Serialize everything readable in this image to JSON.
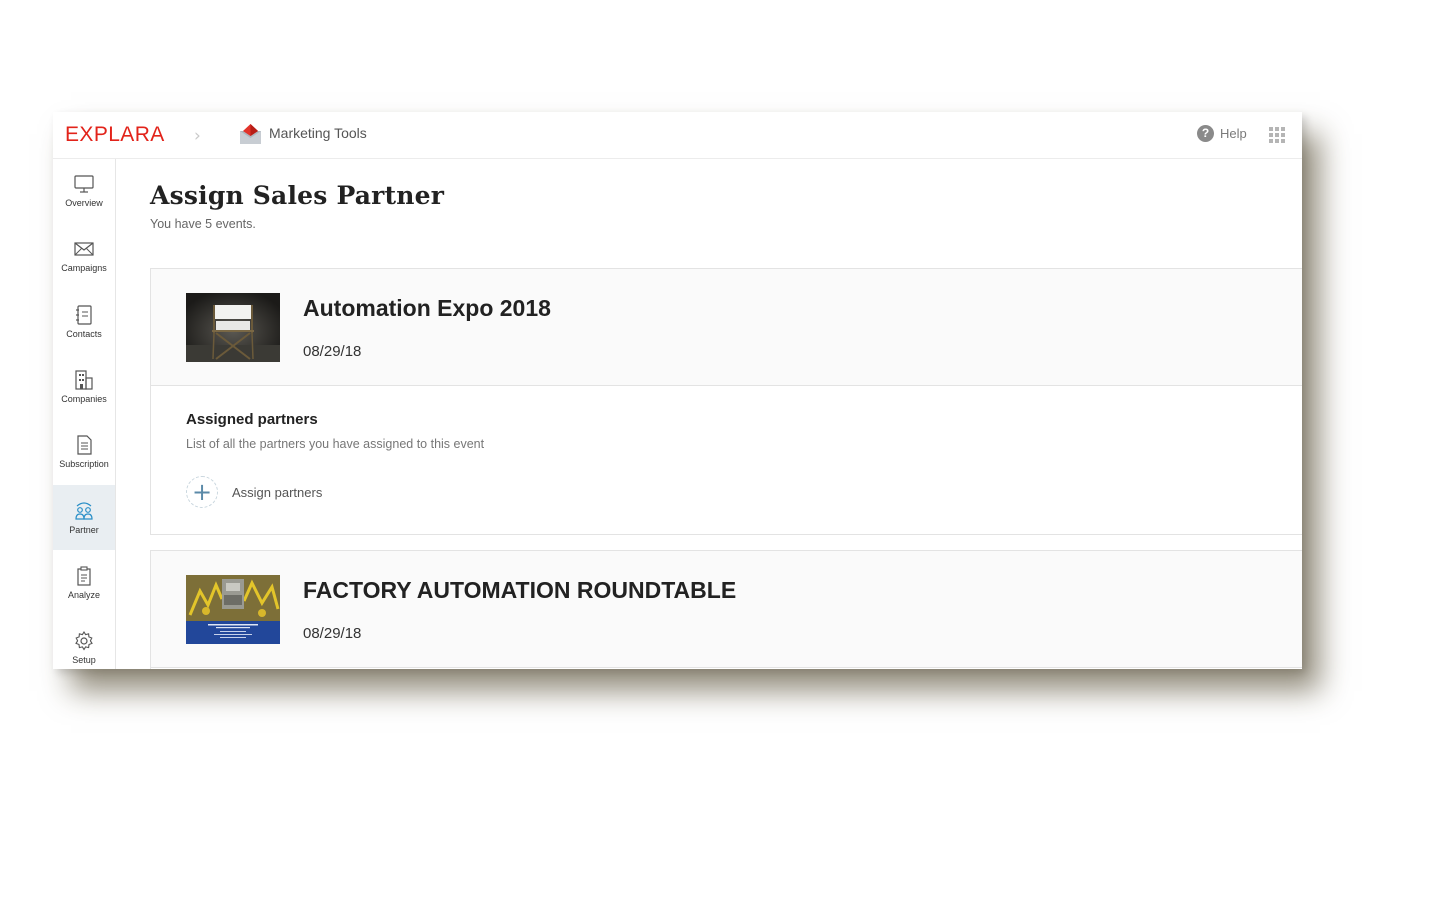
{
  "header": {
    "logo": "EXPLARA",
    "breadcrumb_separator": "›",
    "app_name": "Marketing Tools",
    "help_label": "Help"
  },
  "sidebar": {
    "items": [
      {
        "label": "Overview",
        "icon": "monitor-icon",
        "active": false
      },
      {
        "label": "Campaigns",
        "icon": "envelope-icon",
        "active": false
      },
      {
        "label": "Contacts",
        "icon": "contacts-icon",
        "active": false
      },
      {
        "label": "Companies",
        "icon": "building-icon",
        "active": false
      },
      {
        "label": "Subscription",
        "icon": "document-icon",
        "active": false
      },
      {
        "label": "Partner",
        "icon": "partner-icon",
        "active": true
      },
      {
        "label": "Analyze",
        "icon": "clipboard-icon",
        "active": false
      },
      {
        "label": "Setup",
        "icon": "gear-icon",
        "active": false
      }
    ],
    "active_color": "#e9eef2",
    "accent_color": "#2a8fc7"
  },
  "main": {
    "title": "Assign Sales Partner",
    "subtitle": "You have 5 events.",
    "events": [
      {
        "title": "Automation Expo 2018",
        "date": "08/29/18",
        "assigned_title": "Assigned partners",
        "assigned_subtitle": "List of all the partners you have assigned to this event",
        "assign_label": "Assign partners"
      },
      {
        "title": "FACTORY AUTOMATION ROUNDTABLE",
        "date": "08/29/18"
      }
    ]
  },
  "colors": {
    "brand_red": "#e2231a",
    "text_dark": "#222222",
    "text_muted": "#666666"
  }
}
